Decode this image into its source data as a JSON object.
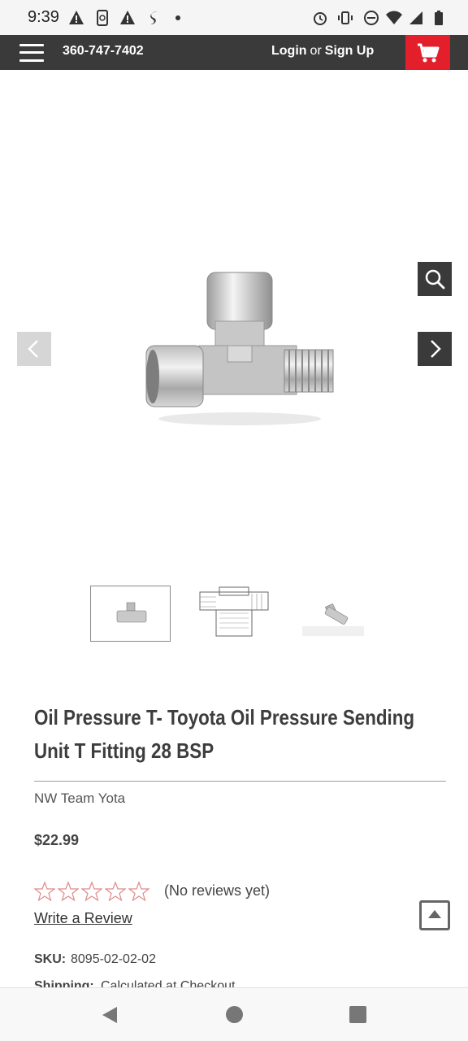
{
  "status_bar": {
    "time": "9:39"
  },
  "header": {
    "phone": "360-747-7402",
    "login_label": "Login",
    "or_label": "or",
    "signup_label": "Sign Up",
    "cart_color": "#e21f2a"
  },
  "gallery": {
    "thumbnails": [
      "thumb-1",
      "thumb-2",
      "thumb-3"
    ]
  },
  "product": {
    "title": "Oil Pressure T- Toyota Oil Pressure Sending Unit T Fitting 28 BSP",
    "brand": "NW Team Yota",
    "price": "$22.99",
    "rating_stars": 0,
    "reviews_text": "(No reviews yet)",
    "write_review_label": "Write a Review",
    "sku_label": "SKU:",
    "sku_value": "8095-02-02-02",
    "shipping_label": "Shipping:",
    "shipping_value": "Calculated at Checkout"
  }
}
